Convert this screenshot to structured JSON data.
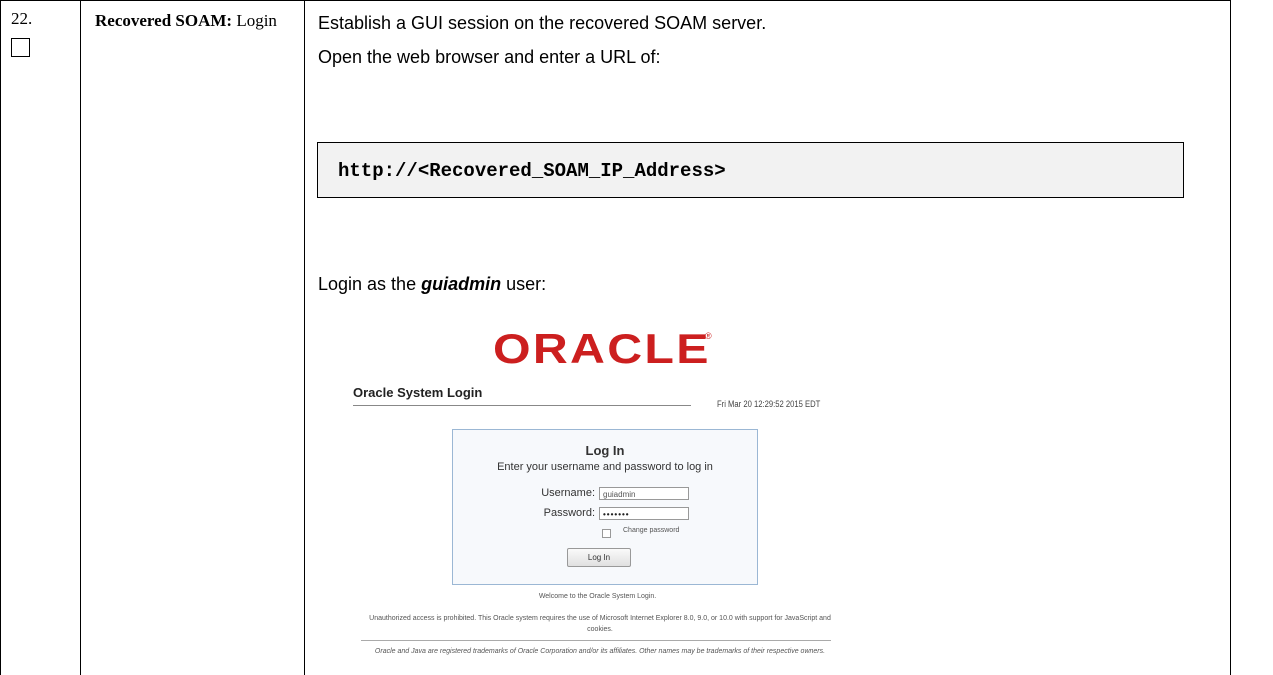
{
  "step": {
    "number": "22.",
    "title_bold": "Recovered SOAM:",
    "title_rest": " Login"
  },
  "content": {
    "line1": "Establish a GUI session on the recovered SOAM server.",
    "line2": "Open the web browser and enter a URL of:",
    "url": "http://<Recovered_SOAM_IP_Address>",
    "login_prefix": "Login as the ",
    "login_user": "guiadmin",
    "login_suffix": " user:"
  },
  "screenshot": {
    "logo": "ORACLE",
    "logo_mark": "®",
    "system_title": "Oracle System Login",
    "datetime": "Fri Mar 20 12:29:52 2015 EDT",
    "box_title": "Log In",
    "box_subtitle": "Enter your username and password to log in",
    "username_label": "Username:",
    "username_value": "guiadmin",
    "password_label": "Password:",
    "password_value": "•••••••",
    "change_password_label": "Change password",
    "login_button": "Log In",
    "welcome": "Welcome to the Oracle System Login.",
    "unauthorized": "Unauthorized access is prohibited. This Oracle system requires the use of Microsoft Internet Explorer 8.0, 9.0, or 10.0 with support for JavaScript and cookies.",
    "trademark": "Oracle and Java are registered trademarks of Oracle Corporation and/or its affiliates. Other names may be trademarks of their respective owners."
  },
  "colors": {
    "oracle_red": "#cc1f1f",
    "code_bg": "#f2f2f2"
  }
}
